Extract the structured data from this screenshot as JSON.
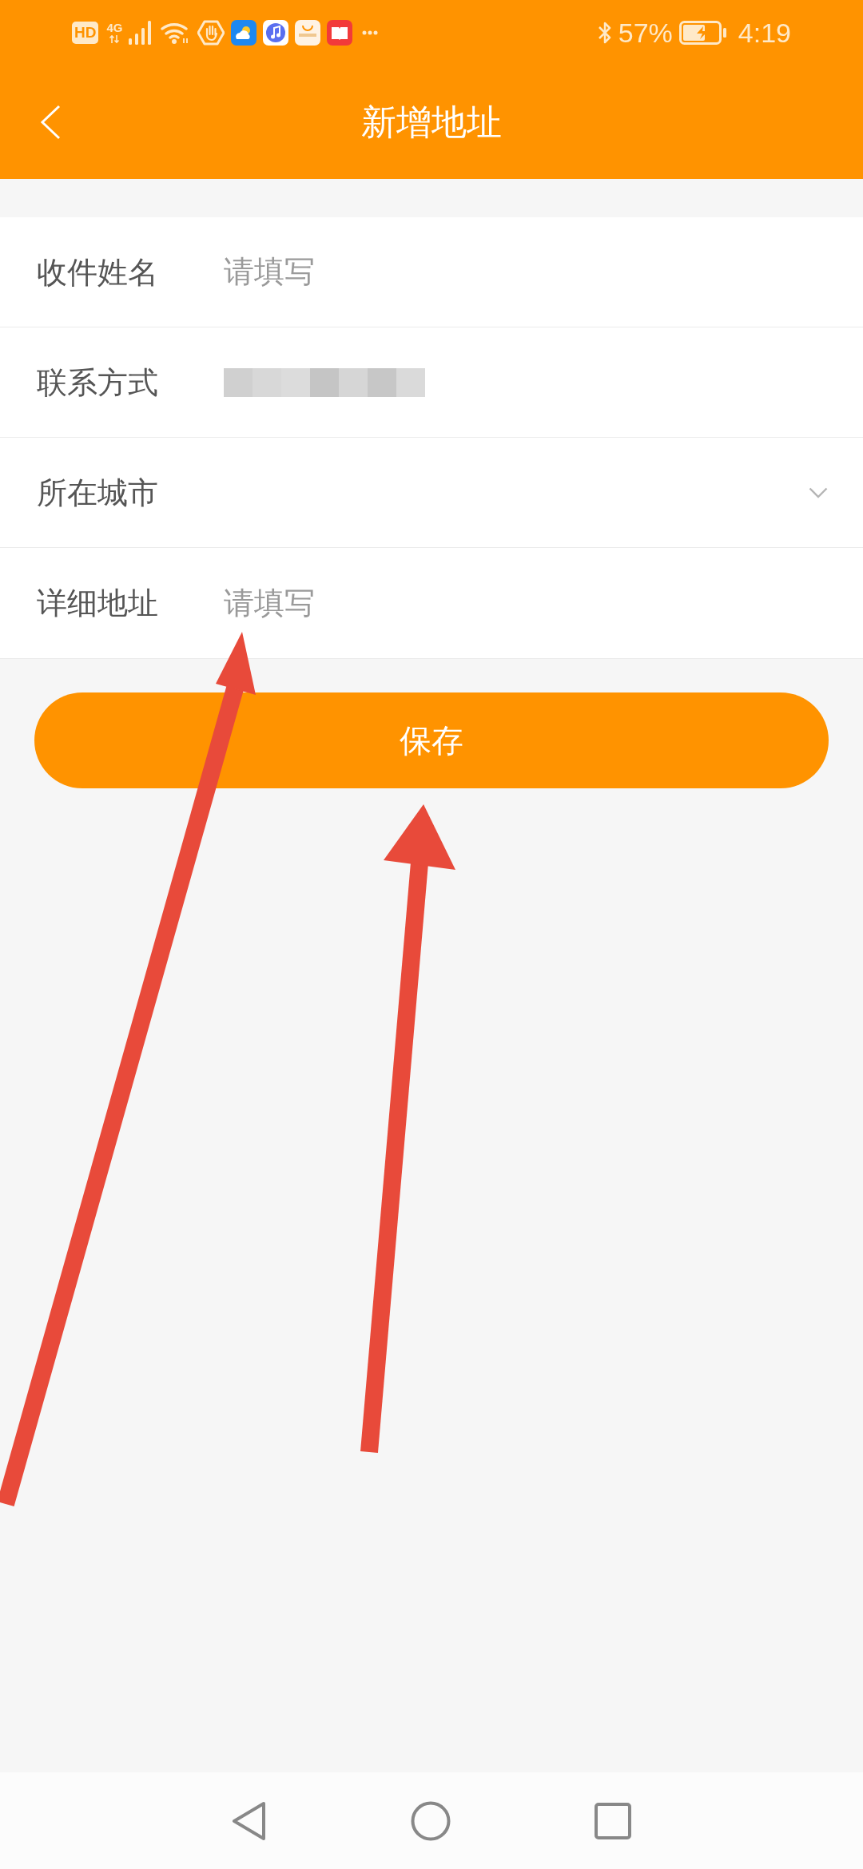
{
  "status_bar": {
    "hd_badge": "HD",
    "network": "4G",
    "battery": "57%",
    "time": "4:19"
  },
  "header": {
    "title": "新增地址"
  },
  "form": {
    "rows": [
      {
        "kind": "text",
        "label": "收件姓名",
        "placeholder": "请填写"
      },
      {
        "kind": "redacted",
        "label": "联系方式"
      },
      {
        "kind": "select",
        "label": "所在城市"
      },
      {
        "kind": "text",
        "label": "详细地址",
        "placeholder": "请填写"
      }
    ]
  },
  "save_button": {
    "label": "保存"
  }
}
